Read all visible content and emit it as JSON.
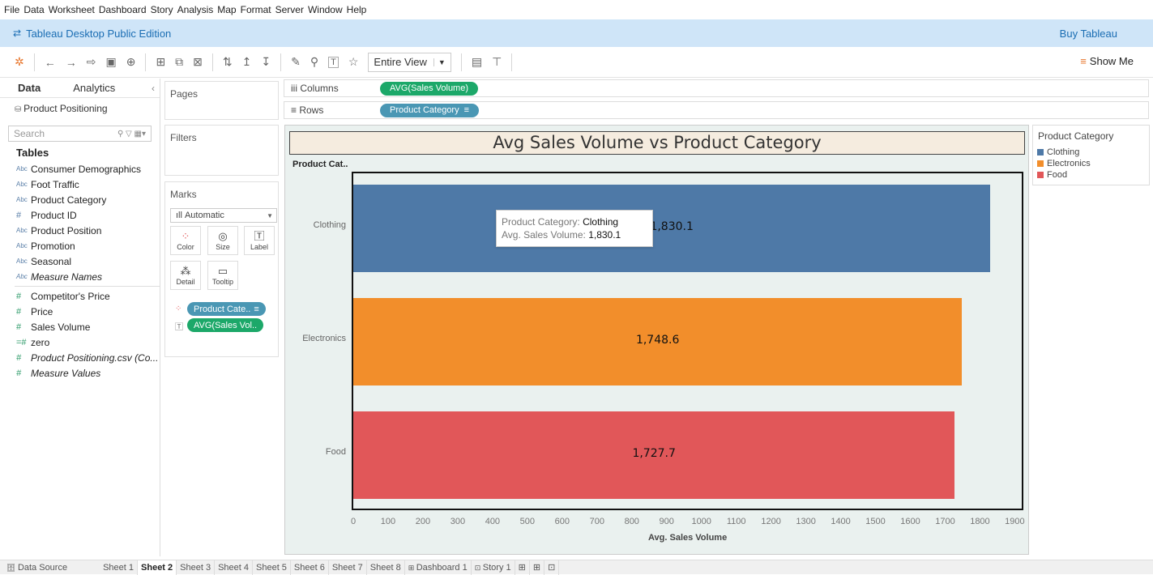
{
  "menu": [
    "File",
    "Data",
    "Worksheet",
    "Dashboard",
    "Story",
    "Analysis",
    "Map",
    "Format",
    "Server",
    "Window",
    "Help"
  ],
  "app": {
    "title": "Tableau Desktop Public Edition",
    "buy_label": "Buy Tableau"
  },
  "toolbar": {
    "fit_label": "Entire View",
    "show_me_label": "Show Me"
  },
  "left_pane": {
    "tabs": [
      "Data",
      "Analytics"
    ],
    "data_source": "Product Positioning",
    "search_placeholder": "Search",
    "tables_heading": "Tables",
    "dimensions": [
      {
        "type": "Abc",
        "name": "Consumer Demographics"
      },
      {
        "type": "Abc",
        "name": "Foot Traffic"
      },
      {
        "type": "Abc",
        "name": "Product Category"
      },
      {
        "type": "#",
        "name": "Product ID"
      },
      {
        "type": "Abc",
        "name": "Product Position"
      },
      {
        "type": "Abc",
        "name": "Promotion"
      },
      {
        "type": "Abc",
        "name": "Seasonal"
      },
      {
        "type": "Abc",
        "name": "Measure Names"
      }
    ],
    "measures": [
      {
        "type": "#",
        "name": "Competitor's Price"
      },
      {
        "type": "#",
        "name": "Price"
      },
      {
        "type": "#",
        "name": "Sales Volume"
      },
      {
        "type": "=#",
        "name": "zero"
      },
      {
        "type": "#",
        "name": "Product Positioning.csv (Co..."
      },
      {
        "type": "#",
        "name": "Measure Values"
      }
    ]
  },
  "cards": {
    "pages": "Pages",
    "filters": "Filters",
    "marks": "Marks",
    "mark_type": "Automatic",
    "mark_buttons": [
      "Color",
      "Size",
      "Label",
      "Detail",
      "Tooltip"
    ],
    "mark_pills": [
      "Product Cate..",
      "AVG(Sales Vol.."
    ]
  },
  "shelves": {
    "columns_label": "Columns",
    "columns_pill": "AVG(Sales Volume)",
    "rows_label": "Rows",
    "rows_pill": "Product Category"
  },
  "viz": {
    "title": "Avg Sales Volume vs Product Category",
    "row_header": "Product Cat..",
    "tooltip": {
      "k1": "Product Category:",
      "v1": "Clothing",
      "k2": "Avg. Sales Volume:",
      "v2": "1,830.1"
    }
  },
  "legend": {
    "title": "Product Category"
  },
  "chart_data": {
    "type": "bar",
    "orientation": "horizontal",
    "title": "Avg Sales Volume vs Product Category",
    "xlabel": "Avg. Sales Volume",
    "ylabel": "Product Cat..",
    "categories": [
      "Clothing",
      "Electronics",
      "Food"
    ],
    "values": [
      1830.1,
      1748.6,
      1727.7
    ],
    "value_labels": [
      "1,830.1",
      "1,748.6",
      "1,727.7"
    ],
    "colors": [
      "#4e79a7",
      "#f28e2b",
      "#e15759"
    ],
    "xlim": [
      0,
      1920
    ],
    "xticks": [
      0,
      100,
      200,
      300,
      400,
      500,
      600,
      700,
      800,
      900,
      1000,
      1100,
      1200,
      1300,
      1400,
      1500,
      1600,
      1700,
      1800,
      1900
    ],
    "legend_position": "right"
  },
  "sheet_tabs": [
    "Data Source",
    "Sheet 1",
    "Sheet 2",
    "Sheet 3",
    "Sheet 4",
    "Sheet 5",
    "Sheet 6",
    "Sheet 7",
    "Sheet 8",
    "Dashboard 1",
    "Story 1"
  ],
  "active_tab": "Sheet 2"
}
